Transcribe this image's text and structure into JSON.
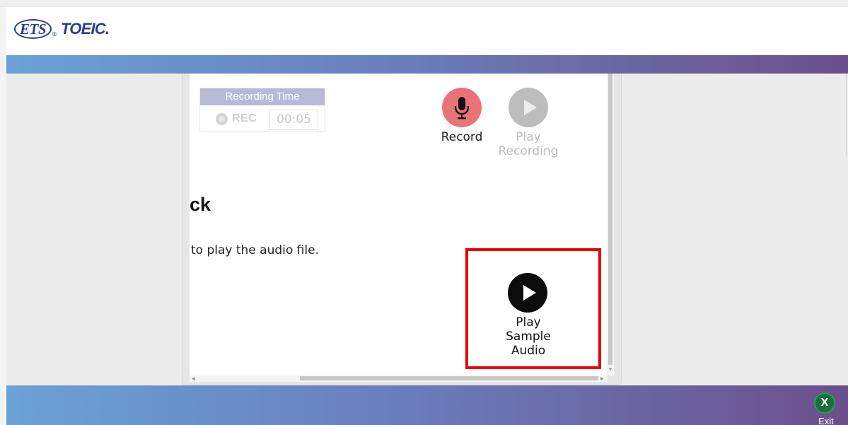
{
  "header": {
    "logo_ets": "ETS",
    "logo_reg": "®",
    "logo_toeic": "TOEIC."
  },
  "recording": {
    "title": "Recording Time",
    "rec_label": "REC",
    "time": "00:05"
  },
  "controls": {
    "record_label": "Record",
    "play_recording_label": "Play Recording",
    "play_sample_label": "Play Sample Audio"
  },
  "content": {
    "heading": "ck",
    "instruction": "to play the audio file."
  },
  "footer": {
    "exit_icon": "X",
    "exit_label": "Exit"
  },
  "colors": {
    "band_start": "#6aa2d8",
    "band_end": "#6c4f8c",
    "record_button": "#e97376",
    "highlight": "#ee0000",
    "exit_button": "#1b6f3a"
  },
  "icons": {
    "record": "microphone-icon",
    "play_recording": "play-icon",
    "play_sample": "play-icon",
    "exit": "close-icon"
  }
}
